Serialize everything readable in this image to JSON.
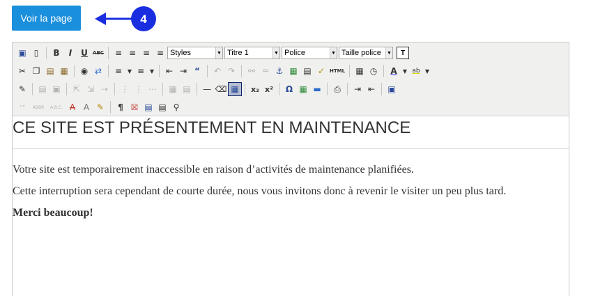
{
  "view_button": {
    "label": "Voir la page"
  },
  "callout": {
    "number": "4",
    "color": "#1a2ee0"
  },
  "toolbar": {
    "styles_label": "Styles",
    "format_label": "Titre 1",
    "font_label": "Police",
    "size_label": "Taille police",
    "bold": "B",
    "italic": "I",
    "underline": "U",
    "strike": "ABC",
    "quote": "“",
    "html": "HTML",
    "omega": "Ω",
    "pilcrow": "¶",
    "t_button": "T",
    "subscript": "x₂",
    "superscript": "x²",
    "hr": "—",
    "quotes_abbr": "“”",
    "abbr": "ABBR",
    "acronym": "A.B.C.",
    "font_color": "A",
    "highlight": "ab"
  },
  "content": {
    "heading": "CE SITE EST PRÉSENTEMENT EN MAINTENANCE",
    "paragraph1": "Votre site est temporairement inaccessible en raison d’activités de maintenance planifiées.",
    "paragraph2": "Cette interruption sera cependant de courte durée, nous vous invitons donc à revenir le visiter un peu plus tard.",
    "paragraph3": "Merci beaucoup!"
  }
}
